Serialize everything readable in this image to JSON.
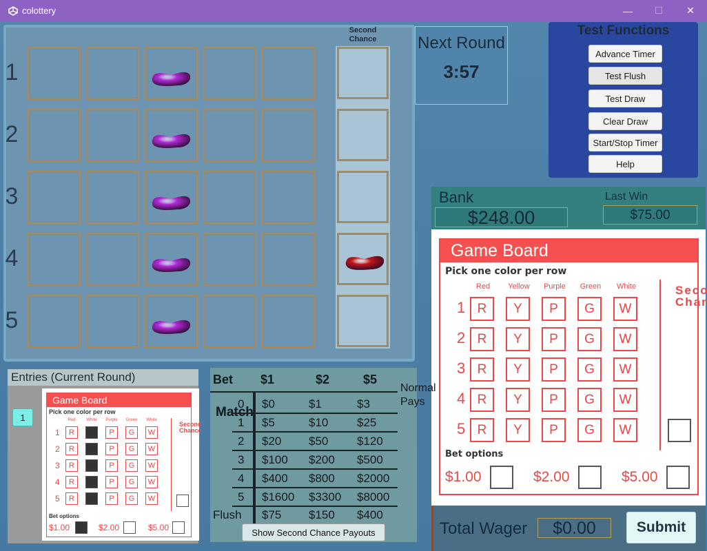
{
  "window": {
    "title": "colottery",
    "minimize": "—",
    "maximize": "☐",
    "close": "✕"
  },
  "draw_board": {
    "row_numbers": [
      "1",
      "2",
      "3",
      "4",
      "5"
    ],
    "second_chance_header": "Second Chance",
    "drawn_colors": [
      "purple",
      "purple",
      "purple",
      "purple",
      "purple"
    ],
    "drawn_column": 3,
    "second_chance_ball": {
      "row": 4,
      "color": "red"
    },
    "colors": {
      "purple": "#b22ad8",
      "red": "#c31818"
    }
  },
  "next_round": {
    "label": "Next Round",
    "time": "3:57"
  },
  "test_functions": {
    "title": "Test Functions",
    "buttons": [
      "Advance Timer",
      "Test Flush",
      "Test Draw",
      "Clear Draw",
      "Start/Stop Timer",
      "Help"
    ]
  },
  "bank": {
    "label": "Bank",
    "value": "$248.00",
    "last_win_label": "Last Win",
    "last_win_value": "$75.00"
  },
  "game_board": {
    "title": "Game Board",
    "subtitle": "Pick one color per row",
    "column_headers": [
      "Red",
      "Yellow",
      "Purple",
      "Green",
      "White"
    ],
    "letters": [
      "R",
      "Y",
      "P",
      "G",
      "W"
    ],
    "row_numbers": [
      "1",
      "2",
      "3",
      "4",
      "5"
    ],
    "second_chance_label": "Second Chance",
    "bet_options_label": "Bet options",
    "bets": [
      "$1.00",
      "$2.00",
      "$5.00"
    ]
  },
  "total": {
    "label": "Total Wager",
    "value": "$0.00",
    "submit_label": "Submit"
  },
  "entries": {
    "header": "Entries  (Current Round)",
    "items": [
      "1"
    ],
    "ticket": {
      "title": "Game Board",
      "subtitle": "Pick one color per row",
      "column_headers": [
        "Red",
        "White",
        "Purple",
        "Green",
        "White"
      ],
      "letters": [
        "R",
        "",
        "P",
        "G",
        "W"
      ],
      "filled_column": 2,
      "row_numbers": [
        "1",
        "2",
        "3",
        "4",
        "5"
      ],
      "second_chance_label": "Second Chance",
      "bet_options_label": "Bet options",
      "bets": [
        "$1.00",
        "$2.00",
        "$5.00"
      ],
      "selected_bet": "$1.00"
    }
  },
  "paytable": {
    "bet_label": "Bet",
    "headers": [
      "$1",
      "$2",
      "$5"
    ],
    "match_label": "Match",
    "rows": [
      {
        "match": "0",
        "pays": [
          "$0",
          "$1",
          "$3"
        ]
      },
      {
        "match": "1",
        "pays": [
          "$5",
          "$10",
          "$25"
        ]
      },
      {
        "match": "2",
        "pays": [
          "$20",
          "$50",
          "$120"
        ]
      },
      {
        "match": "3",
        "pays": [
          "$100",
          "$200",
          "$500"
        ]
      },
      {
        "match": "4",
        "pays": [
          "$400",
          "$800",
          "$2000"
        ]
      },
      {
        "match": "5",
        "pays": [
          "$1600",
          "$3300",
          "$8000"
        ]
      }
    ],
    "flush_label": "Flush",
    "flush_pays": [
      "$75",
      "$150",
      "$400"
    ],
    "side_label": "Normal Pays",
    "button_label": "Show Second Chance Payouts"
  }
}
